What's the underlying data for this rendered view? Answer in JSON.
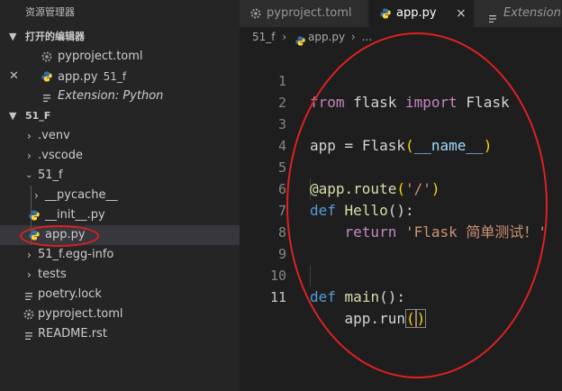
{
  "sidebar": {
    "title": "资源管理器",
    "open_editors": {
      "label": "打开的编辑器",
      "items": [
        {
          "name": "pyproject.toml",
          "extra": ""
        },
        {
          "name": "app.py",
          "extra": "51_f"
        },
        {
          "name": "Extension: Python",
          "extra": ""
        }
      ]
    },
    "project": {
      "label": "51_F",
      "tree": [
        {
          "name": ".venv"
        },
        {
          "name": ".vscode"
        },
        {
          "name": "51_f"
        },
        {
          "name": "__pycache__"
        },
        {
          "name": "__init__.py"
        },
        {
          "name": "app.py"
        },
        {
          "name": "51_f.egg-info"
        },
        {
          "name": "tests"
        },
        {
          "name": "poetry.lock"
        },
        {
          "name": "pyproject.toml"
        },
        {
          "name": "README.rst"
        }
      ]
    }
  },
  "tabs": [
    {
      "label": "pyproject.toml"
    },
    {
      "label": "app.py",
      "close": "×"
    },
    {
      "label": "Extension: Py"
    }
  ],
  "breadcrumb": {
    "folder": "51_f",
    "file": "app.py",
    "more": "..."
  },
  "code": {
    "line_numbers": [
      "1",
      "2",
      "3",
      "4",
      "5",
      "6",
      "7",
      "8",
      "9",
      "10",
      "11"
    ],
    "tokens": {
      "from": "from",
      "flask": "flask",
      "import": "import",
      "Flask": "Flask",
      "app": "app",
      "eq": "=",
      "Flask2": "Flask",
      "lp": "(",
      "name": "__name__",
      "rp": ")",
      "at": "@app.route",
      "lp2": "(",
      "route_str": "'/'",
      "rp2": ")",
      "def1": "def",
      "hello": "Hello",
      "hello_paren": "():",
      "return": "return",
      "ret_str": "'Flask 简单测试！'",
      "def2": "def",
      "main": "main",
      "main_paren": "():",
      "apprun": "app.run",
      "run_lp": "(",
      "run_rp": ")"
    }
  },
  "colors": {
    "annotation": "#e02020",
    "accent": "#569cd6"
  }
}
